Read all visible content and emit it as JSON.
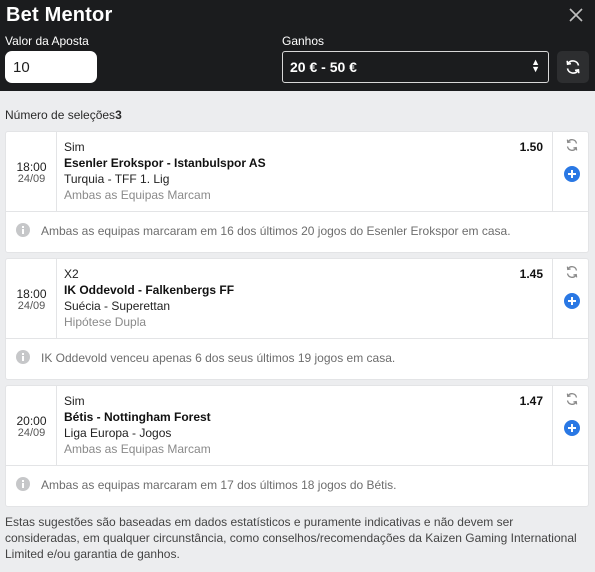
{
  "header": {
    "title": "Bet Mentor",
    "stake_label": "Valor da Aposta",
    "stake_value": "10",
    "winnings_label": "Ganhos",
    "winnings_range": "20 € - 50 €"
  },
  "selections": {
    "label": "Número de seleções",
    "count": "3"
  },
  "picks": [
    {
      "time": "18:00",
      "date": "24/09",
      "market": "Sim",
      "match": "Esenler Erokspor - Istanbulspor AS",
      "league": "Turquia - TFF 1. Lig",
      "bet_type": "Ambas as Equipas Marcam",
      "odds": "1.50",
      "info": "Ambas as equipas marcaram em 16 dos últimos 20 jogos do Esenler Erokspor em casa."
    },
    {
      "time": "18:00",
      "date": "24/09",
      "market": "X2",
      "match": "IK Oddevold - Falkenbergs FF",
      "league": "Suécia - Superettan",
      "bet_type": "Hipótese Dupla",
      "odds": "1.45",
      "info": "IK Oddevold venceu apenas 6 dos seus últimos 19 jogos em casa."
    },
    {
      "time": "20:00",
      "date": "24/09",
      "market": "Sim",
      "match": "Bétis - Nottingham Forest",
      "league": "Liga Europa - Jogos",
      "bet_type": "Ambas as Equipas Marcam",
      "odds": "1.47",
      "info": "Ambas as equipas marcaram em 17 dos últimos 18 jogos do Bétis."
    }
  ],
  "disclaimer": "Estas sugestões são baseadas em dados estatísticos e puramente indicativas e não devem ser consideradas, em qualquer circunstância, como conselhos/recomendações da Kaizen Gaming International Limited e/ou garantia de ganhos.",
  "icons": {
    "close": "close-icon",
    "refresh": "refresh-icon",
    "swap": "swap-icon",
    "add": "plus-icon",
    "info": "info-icon"
  },
  "colors": {
    "header_bg": "#1b1c1e",
    "page_bg": "#ecedef",
    "accent": "#2a78e4"
  }
}
